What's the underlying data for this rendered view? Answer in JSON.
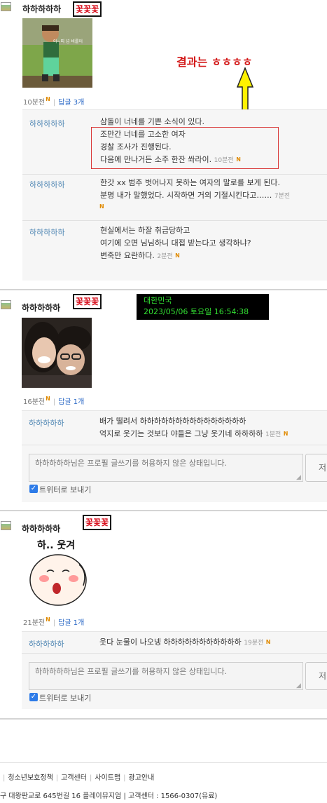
{
  "posts": [
    {
      "author": "하하하하하",
      "badge": "꽃꽃꽃",
      "image_caption": "아~띠 넘 비를어",
      "meta_time": "10분전",
      "reply_label": "답글 3개",
      "annotation": "결과는 ㅎㅎㅎㅎ",
      "comments": [
        {
          "author": "하하하하하",
          "lines": [
            "삼돌이 너네를 기쁜 소식이 있다.",
            "조만간 너네를 고소한 여자",
            "경찰 조사가 진행된다.",
            "다음에 만나거든 소주 한잔 쏴라이."
          ],
          "time": "10분전"
        },
        {
          "author": "하하하하하",
          "lines": [
            "한갓 xx 범주 벗어나지 못하는 여자의 말로를 보게 된다.",
            "분명 내가 말했었다. 시작하면 거의 기절시킨다고……"
          ],
          "time": "7분전"
        },
        {
          "author": "하하하하하",
          "lines": [
            "현실에서는 하잘 취급당하고",
            "여기에 오면 님님하니 대접 받는다고 생각하냐?",
            "변죽만 요란하다."
          ],
          "time": "2분전"
        }
      ]
    },
    {
      "author": "하하하하하",
      "badge": "꽃꽃꽃",
      "timestamp_box": {
        "line1": "대한민국",
        "line2": "2023/05/06 토요일 16:54:38"
      },
      "meta_time": "16분전",
      "reply_label": "답글 1개",
      "comments": [
        {
          "author": "하하하하하",
          "lines": [
            "배가 떨려서 하하하하하하하하하하하하하하하",
            "억지로 웃기는 것보다 야들은 그냥 웃기네 하하하하"
          ],
          "time": "1분전"
        }
      ],
      "input_placeholder": "하하하하하님은 프로필 글쓰기를 허용하지 않은 상태입니다.",
      "submit_label": "저",
      "twitter_label": "트위터로 보내기"
    },
    {
      "author": "하하하하하",
      "badge": "꽃꽃꽃",
      "sticker_text": "하.. 웃겨",
      "meta_time": "21분전",
      "reply_label": "답글 1개",
      "comments": [
        {
          "author": "하하하하하",
          "lines": [
            "웃다 눈물이 나오넹 하하하하하하하하하하하"
          ],
          "time": "19분전"
        }
      ],
      "input_placeholder": "하하하하하님은 프로필 글쓰기를 허용하지 않은 상태입니다.",
      "submit_label": "저",
      "twitter_label": "트위터로 보내기"
    }
  ],
  "new_mark": "N",
  "footer": {
    "links": [
      "청소년보호정책",
      "고객센터",
      "사이트맵",
      "광고안내"
    ],
    "address": "구 대왕판교로 645번길 16 플레이뮤지엄 | 고객센터 : 1566-0307(유료)"
  },
  "colors": {
    "badge_red": "#d8101e",
    "annotation_red": "#d31919",
    "arrow_yellow": "#fff200",
    "link_blue": "#2867c5",
    "clock_green": "#33e033"
  }
}
